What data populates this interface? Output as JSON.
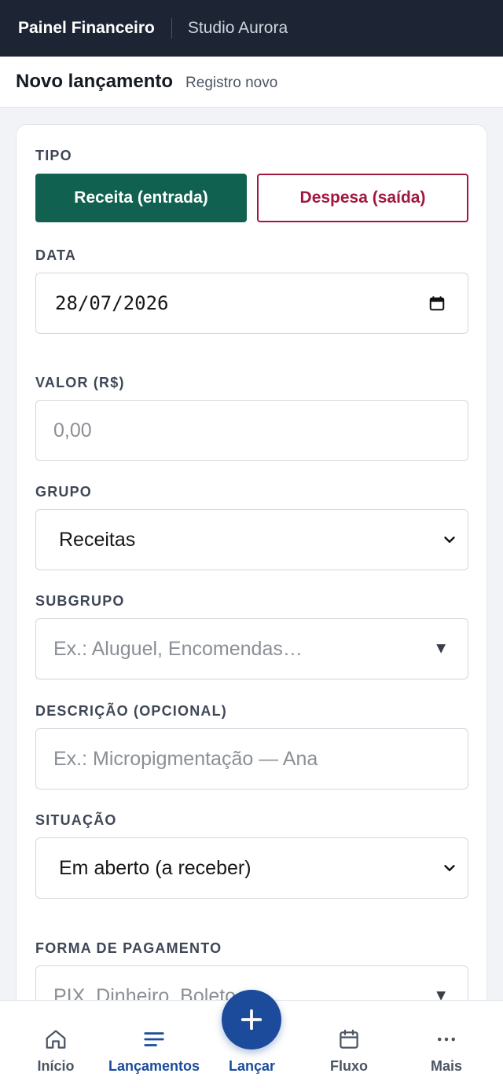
{
  "header": {
    "brand": "Painel Financeiro",
    "company": "Studio Aurora"
  },
  "subheader": {
    "title": "Novo lançamento",
    "subtitle": "Registro novo"
  },
  "form": {
    "tipo": {
      "label": "TIPO",
      "receita": "Receita (entrada)",
      "despesa": "Despesa (saída)",
      "selected": "receita"
    },
    "data": {
      "label": "DATA",
      "value": "28/07/2026"
    },
    "valor": {
      "label": "VALOR (R$)",
      "placeholder": "0,00"
    },
    "grupo": {
      "label": "GRUPO",
      "value": "Receitas"
    },
    "subgrupo": {
      "label": "SUBGRUPO",
      "placeholder": "Ex.: Aluguel, Encomendas…"
    },
    "descricao": {
      "label": "DESCRIÇÃO (OPCIONAL)",
      "placeholder": "Ex.: Micropigmentação — Ana"
    },
    "situacao": {
      "label": "SITUAÇÃO",
      "value": "Em aberto (a receber)"
    },
    "forma": {
      "label": "FORMA DE PAGAMENTO",
      "placeholder": "PIX, Dinheiro, Boleto…"
    }
  },
  "nav": {
    "items": [
      {
        "label": "Início",
        "icon": "home-icon"
      },
      {
        "label": "Lançamentos",
        "icon": "list-icon"
      },
      {
        "label": "Lançar",
        "icon": "plus-icon"
      },
      {
        "label": "Fluxo",
        "icon": "calendar-icon"
      },
      {
        "label": "Mais",
        "icon": "more-icon"
      }
    ],
    "active": "Lançamentos"
  },
  "colors": {
    "topbar": "#1d2433",
    "receita": "#116150",
    "despesa": "#a3183f",
    "accent": "#1b4b9a"
  }
}
